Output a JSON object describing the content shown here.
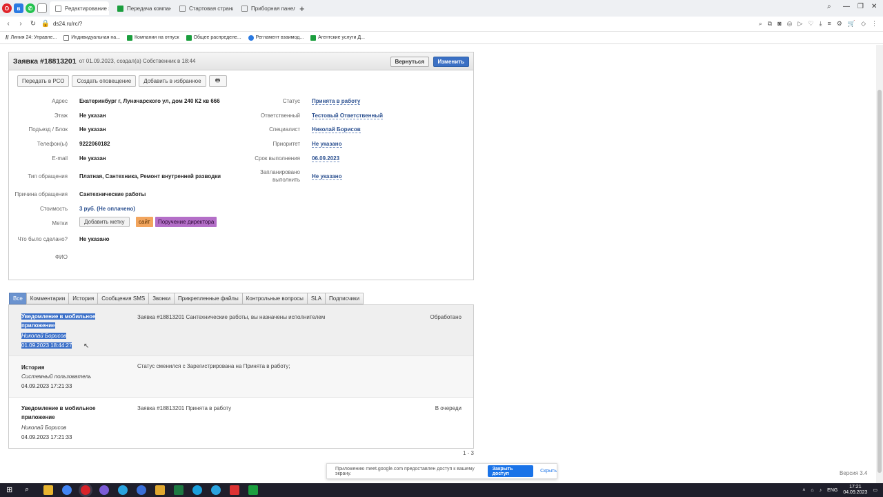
{
  "browser": {
    "tabs": [
      {
        "label": "Редактирование заявки",
        "active": true
      },
      {
        "label": "Передача компаний на",
        "active": false
      },
      {
        "label": "Стартовая страница",
        "active": false
      },
      {
        "label": "Приборная панель",
        "active": false
      }
    ],
    "new_tab": "+",
    "url": "ds24.ru/rc/?",
    "bookmarks": [
      "Линия 24: Управле...",
      "Индивидуальная на...",
      "Компании на отпуск",
      "Общее распределе...",
      "Регламент взаимод...",
      "Агентские услуги Д..."
    ]
  },
  "header": {
    "title": "Заявка #18813201",
    "subtitle": "от 01.09.2023, создал(а) Собственник в 18:44",
    "back_label": "Вернуться",
    "edit_label": "Изменить"
  },
  "toolbar": {
    "pso_label": "Передать в РСО",
    "notify_label": "Создать оповещение",
    "fav_label": "Добавить в избранное",
    "print_label": "🖶"
  },
  "fields": {
    "address_label": "Адрес",
    "address": "Екатеринбург г, Луначарского ул, дом 240 К2 кв 666",
    "floor_label": "Этаж",
    "floor": "Не указан",
    "entrance_label": "Подъезд / Блок",
    "entrance": "Не указан",
    "phone_label": "Телефон(ы)",
    "phone": "9222060182",
    "email_label": "E-mail",
    "email": "Не указан",
    "type_label": "Тип обращения",
    "type": "Платная, Сантехника, Ремонт внутренней разводки",
    "reason_label": "Причина обращения",
    "reason": "Сантехнические работы",
    "cost_label": "Стоимость",
    "cost": "3 руб. (Не оплачено)",
    "tags_label": "Метки",
    "add_tag_label": "Добавить метку",
    "tag1": "сайт",
    "tag2": "Поручение директора",
    "done_label": "Что было сделано?",
    "done": "Не указано",
    "fio_label": "ФИО",
    "status_label": "Статус",
    "status": "Принята в работу",
    "responsible_label": "Ответственный",
    "responsible": "Тестовый Ответственный",
    "specialist_label": "Специалист",
    "specialist": "Николай Борисов",
    "priority_label": "Приоритет",
    "priority": "Не указано",
    "deadline_label": "Срок выполнения",
    "deadline": "06.09.2023",
    "planned_label_1": "Запланировано",
    "planned_label_2": "выполнить",
    "planned": "Не указано"
  },
  "tabs": [
    "Все",
    "Комментарии",
    "История",
    "Сообщения SMS",
    "Звонки",
    "Прикрепленные файлы",
    "Контрольные вопросы",
    "SLA",
    "Подписчики"
  ],
  "feed": [
    {
      "title_1": "Уведомление в мобильное",
      "title_2": "приложение",
      "author": "Николай Борисов",
      "date": "01.09.2023 18:44:27",
      "message": "Заявка #18813201  Сантехнические работы, вы назначены исполнителем",
      "status": "Обработано"
    },
    {
      "title_1": "История",
      "title_2": "",
      "author": "Системный пользователь",
      "date": "04.09.2023 17:21:33",
      "message": "Статус сменился с Зарегистрирована на Принята в работу;",
      "status": ""
    },
    {
      "title_1": "Уведомление в мобильное",
      "title_2": "приложение",
      "author": "Николай Борисов",
      "date": "04.09.2023 17:21:33",
      "message": "Заявка #18813201 Принята в работу",
      "status": "В очереди"
    }
  ],
  "counter": "1 - 3",
  "version": "Версия 3.4",
  "notification": {
    "text": "Приложению meet.google.com предоставлен доступ к вашему экрану.",
    "close_label": "Закрыть доступ",
    "hide_label": "Скрыть"
  },
  "taskbar": {
    "lang": "ENG",
    "time": "17:21",
    "date": "04.09.2023"
  }
}
